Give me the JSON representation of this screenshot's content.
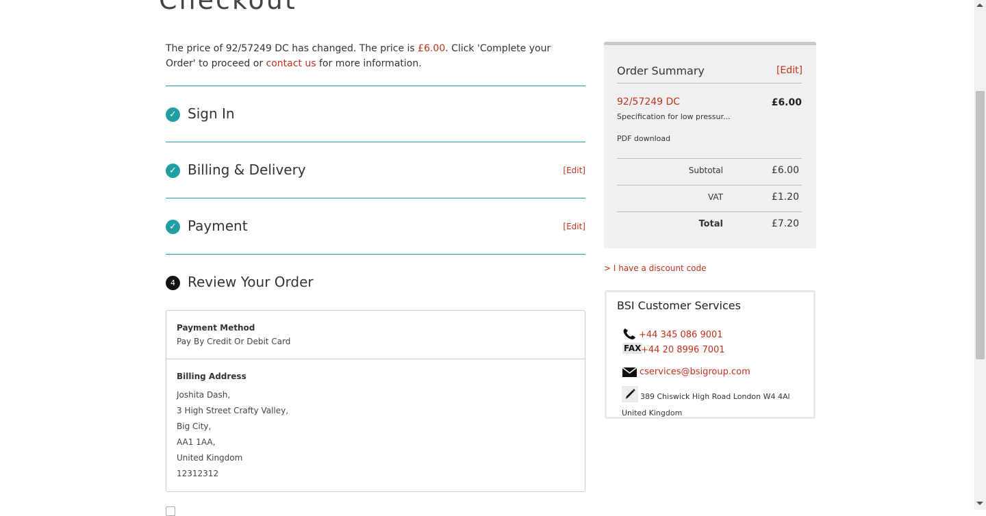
{
  "page": {
    "title": "Checkout"
  },
  "notice": {
    "part1": "The price of 92/57249 DC has changed. The price is ",
    "price": "£6.00",
    "part2": ". Click 'Complete your Order' to proceed or ",
    "contact_link": "contact us",
    "part3": " for more information."
  },
  "steps": [
    {
      "icon": "check-icon",
      "title": "Sign In",
      "edit": ""
    },
    {
      "icon": "check-icon",
      "title": "Billing & Delivery",
      "edit": "[Edit]"
    },
    {
      "icon": "check-icon",
      "title": "Payment",
      "edit": "[Edit]"
    },
    {
      "icon": "number-badge",
      "number": "4",
      "title": "Review Your Order"
    }
  ],
  "review": {
    "payment_method_label": "Payment Method",
    "payment_method_value": "Pay By Credit Or Debit Card",
    "billing_address_label": "Billing Address",
    "billing_address": [
      "Joshita Dash,",
      "3 High Street Crafty Valley,",
      "Big City,",
      "AA1 1AA,",
      "United Kingdom",
      "12312312"
    ]
  },
  "order_summary": {
    "title": "Order Summary",
    "edit": "[Edit]",
    "item": {
      "code": "92/57249 DC",
      "price": "£6.00",
      "description": "Specification for low pressur...",
      "format": "PDF download"
    },
    "totals": [
      {
        "label": "Subtotal",
        "value": "£6.00"
      },
      {
        "label": "VAT",
        "value": "£1.20"
      },
      {
        "label": "Total",
        "value": "£7.20"
      }
    ]
  },
  "discount_link": "> I have a discount code",
  "customer_services": {
    "title": "BSI Customer Services",
    "phone": "+44 345 086 9001",
    "fax_label": "FAX",
    "fax": "+44 20 8996 7001",
    "email": "cservices@bsigroup.com",
    "address": "389 Chiswick High Road London W4 4Al United Kingdom",
    "icons": [
      "phone-icon",
      "fax-icon",
      "envelope-icon",
      "pencil-icon"
    ]
  },
  "colors": {
    "accent_red": "#c1311b",
    "teal": "#1f9ea3",
    "rule": "#2a97a7"
  }
}
